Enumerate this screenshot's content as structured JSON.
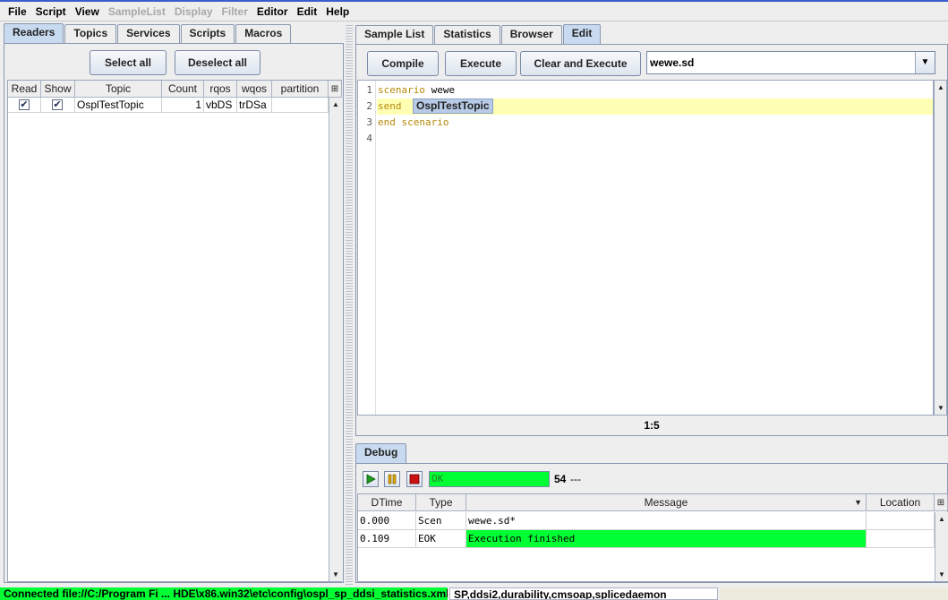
{
  "menu": [
    {
      "label": "File",
      "disabled": false
    },
    {
      "label": "Script",
      "disabled": false
    },
    {
      "label": "View",
      "disabled": false
    },
    {
      "label": "SampleList",
      "disabled": true
    },
    {
      "label": "Display",
      "disabled": true
    },
    {
      "label": "Filter",
      "disabled": true
    },
    {
      "label": "Editor",
      "disabled": false
    },
    {
      "label": "Edit",
      "disabled": false
    },
    {
      "label": "Help",
      "disabled": false
    }
  ],
  "left_tabs": [
    "Readers",
    "Topics",
    "Services",
    "Scripts",
    "Macros"
  ],
  "readers": {
    "select_all": "Select all",
    "deselect_all": "Deselect all",
    "columns": [
      "Read",
      "Show",
      "Topic",
      "Count",
      "rqos",
      "wqos",
      "partition"
    ],
    "rows": [
      {
        "read": true,
        "show": true,
        "topic": "OsplTestTopic",
        "count": "1",
        "rqos": "vbDS",
        "wqos": "trDSa",
        "partition": ""
      }
    ],
    "check_glyph": "✔"
  },
  "right_tabs": [
    "Sample List",
    "Statistics",
    "Browser",
    "Edit"
  ],
  "edit": {
    "compile": "Compile",
    "execute": "Execute",
    "clear_execute": "Clear and Execute",
    "script_file": "wewe.sd",
    "lines": [
      {
        "n": "1",
        "kw1": "scenario",
        "rest": " wewe"
      },
      {
        "n": "2",
        "kw1": "send",
        "rest": ""
      },
      {
        "n": "3",
        "kw1": "end scenario",
        "rest": ""
      },
      {
        "n": "4",
        "kw1": "",
        "rest": ""
      }
    ],
    "completion": "OsplTestTopic",
    "cursor_pos": "1:5"
  },
  "debug": {
    "tab": "Debug",
    "status": "OK",
    "count": "54",
    "dashes": "---",
    "columns": [
      "DTime",
      "Type",
      "Message",
      "Location"
    ],
    "rows": [
      {
        "dtime": "0.000",
        "type": "Scen",
        "message": "wewe.sd*",
        "location": "",
        "highlight": false
      },
      {
        "dtime": "0.109",
        "type": "EOK",
        "message": "Execution finished",
        "location": "",
        "highlight": true
      }
    ]
  },
  "status": {
    "connection": "Connected file://C:/Program Fi ... HDE\\x86.win32\\etc\\config\\ospl_sp_ddsi_statistics.xml",
    "services": "SP,ddsi2,durability,cmsoap,splicedaemon"
  },
  "colors": {
    "ok_green": "#00ff33",
    "tab_selected": "#c8daf0",
    "current_line": "#ffffb4"
  }
}
